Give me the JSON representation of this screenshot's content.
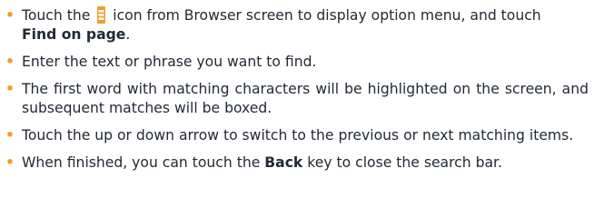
{
  "bullet_glyph": "•",
  "accent_color": "#f39a2e",
  "text_color": "#222a35",
  "items": [
    {
      "t1": "Touch the",
      "icon": "menu-icon",
      "t2": "icon from Browser screen to display option menu, and touch",
      "b": "Find on page",
      "t3": "."
    },
    {
      "t1": "Enter the text or phrase you want to find."
    },
    {
      "t1": "The first word with matching characters will be highlighted on the screen, and subsequent matches will be boxed."
    },
    {
      "t1": "Touch the up or down arrow to switch to the previous or next matching items."
    },
    {
      "t1": "When finished, you can touch the",
      "b": "Back",
      "t2": "key to close the search bar."
    }
  ]
}
